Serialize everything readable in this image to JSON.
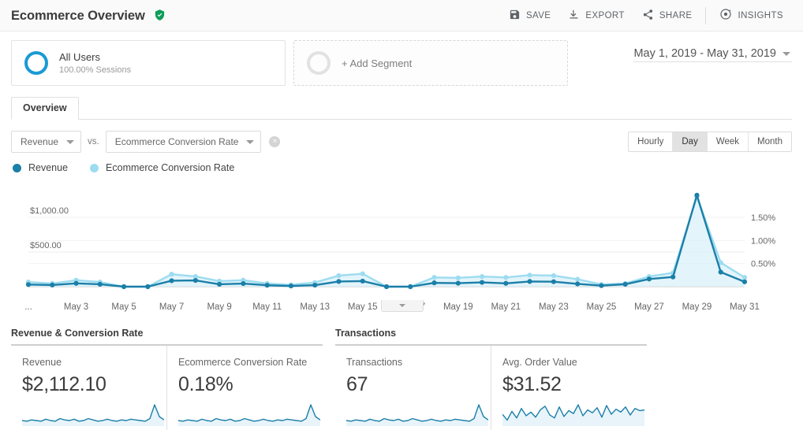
{
  "header": {
    "title": "Ecommerce Overview",
    "badge_icon": "verified-shield-icon",
    "badge_color": "#0f9d58",
    "toolbar": [
      {
        "label": "SAVE",
        "icon": "save-icon"
      },
      {
        "label": "EXPORT",
        "icon": "export-icon"
      },
      {
        "label": "SHARE",
        "icon": "share-icon"
      },
      {
        "label": "INSIGHTS",
        "icon": "insights-icon"
      }
    ]
  },
  "segments": {
    "all_users": {
      "name": "All Users",
      "sub": "100.00% Sessions",
      "ring_color": "#1a9ad4"
    },
    "add_segment": {
      "label": "+ Add Segment"
    }
  },
  "date_range": {
    "value": "May 1, 2019 - May 31, 2019"
  },
  "tabs": [
    {
      "label": "Overview",
      "active": true
    }
  ],
  "metric_selectors": {
    "primary": "Revenue",
    "vs_label": "vs.",
    "secondary": "Ecommerce Conversion Rate",
    "remove_label": "×"
  },
  "granularity": {
    "options": [
      "Hourly",
      "Day",
      "Week",
      "Month"
    ],
    "selected": "Day"
  },
  "legend": [
    {
      "label": "Revenue",
      "color": "#1b7fa8"
    },
    {
      "label": "Ecommerce Conversion Rate",
      "color": "#9ddcf0"
    }
  ],
  "chart_data": {
    "type": "line",
    "title": "Revenue vs Ecommerce Conversion Rate",
    "xlabel": "",
    "ylabel": "Revenue",
    "y2label": "Ecommerce Conversion Rate",
    "grid": true,
    "legend_position": "top-left",
    "x": [
      "May 1",
      "May 2",
      "May 3",
      "May 4",
      "May 5",
      "May 6",
      "May 7",
      "May 8",
      "May 9",
      "May 10",
      "May 11",
      "May 12",
      "May 13",
      "May 14",
      "May 15",
      "May 16",
      "May 17",
      "May 18",
      "May 19",
      "May 20",
      "May 21",
      "May 22",
      "May 23",
      "May 24",
      "May 25",
      "May 26",
      "May 27",
      "May 28",
      "May 29",
      "May 30",
      "May 31"
    ],
    "xtick_labels": [
      "...",
      "May 3",
      "May 5",
      "May 7",
      "May 9",
      "May 11",
      "May 13",
      "May 15",
      "May 17",
      "May 19",
      "May 21",
      "May 23",
      "May 25",
      "May 27",
      "May 29",
      "May 31"
    ],
    "ytick_labels": [
      "$500.00",
      "$1,000.00"
    ],
    "ytick_values": [
      500,
      1000
    ],
    "ylim": [
      0,
      1500
    ],
    "y2tick_labels": [
      "0.50%",
      "1.00%",
      "1.50%"
    ],
    "y2tick_values": [
      0.5,
      1.0,
      1.5
    ],
    "y2lim": [
      0,
      2.25
    ],
    "series": [
      {
        "name": "Revenue",
        "color": "#1b7fa8",
        "axis": "left",
        "values": [
          30,
          24,
          48,
          35,
          0,
          0,
          86,
          90,
          35,
          45,
          20,
          10,
          22,
          75,
          80,
          0,
          0,
          55,
          50,
          62,
          48,
          75,
          72,
          40,
          15,
          35,
          110,
          140,
          1320,
          210,
          70
        ]
      },
      {
        "name": "Ecommerce Conversion Rate",
        "color": "#9ddcf0",
        "axis": "right",
        "fill": true,
        "values": [
          0.1,
          0.07,
          0.14,
          0.1,
          0.0,
          0.0,
          0.27,
          0.22,
          0.12,
          0.14,
          0.07,
          0.04,
          0.09,
          0.24,
          0.28,
          0.0,
          0.0,
          0.2,
          0.19,
          0.22,
          0.2,
          0.25,
          0.24,
          0.16,
          0.05,
          0.07,
          0.22,
          0.3,
          1.95,
          0.52,
          0.2
        ]
      }
    ]
  },
  "panels": [
    {
      "title": "Revenue & Conversion Rate",
      "metrics": [
        {
          "label": "Revenue",
          "value": "$2,112.10",
          "spark": "flat-spike"
        },
        {
          "label": "Ecommerce Conversion Rate",
          "value": "0.18%",
          "spark": "flat-spike"
        }
      ]
    },
    {
      "title": "Transactions",
      "metrics": [
        {
          "label": "Transactions",
          "value": "67",
          "spark": "flat-spike"
        },
        {
          "label": "Avg. Order Value",
          "value": "$31.52",
          "spark": "variable"
        }
      ]
    }
  ],
  "scroll_handle": {
    "icon": "chevron-down-icon"
  }
}
